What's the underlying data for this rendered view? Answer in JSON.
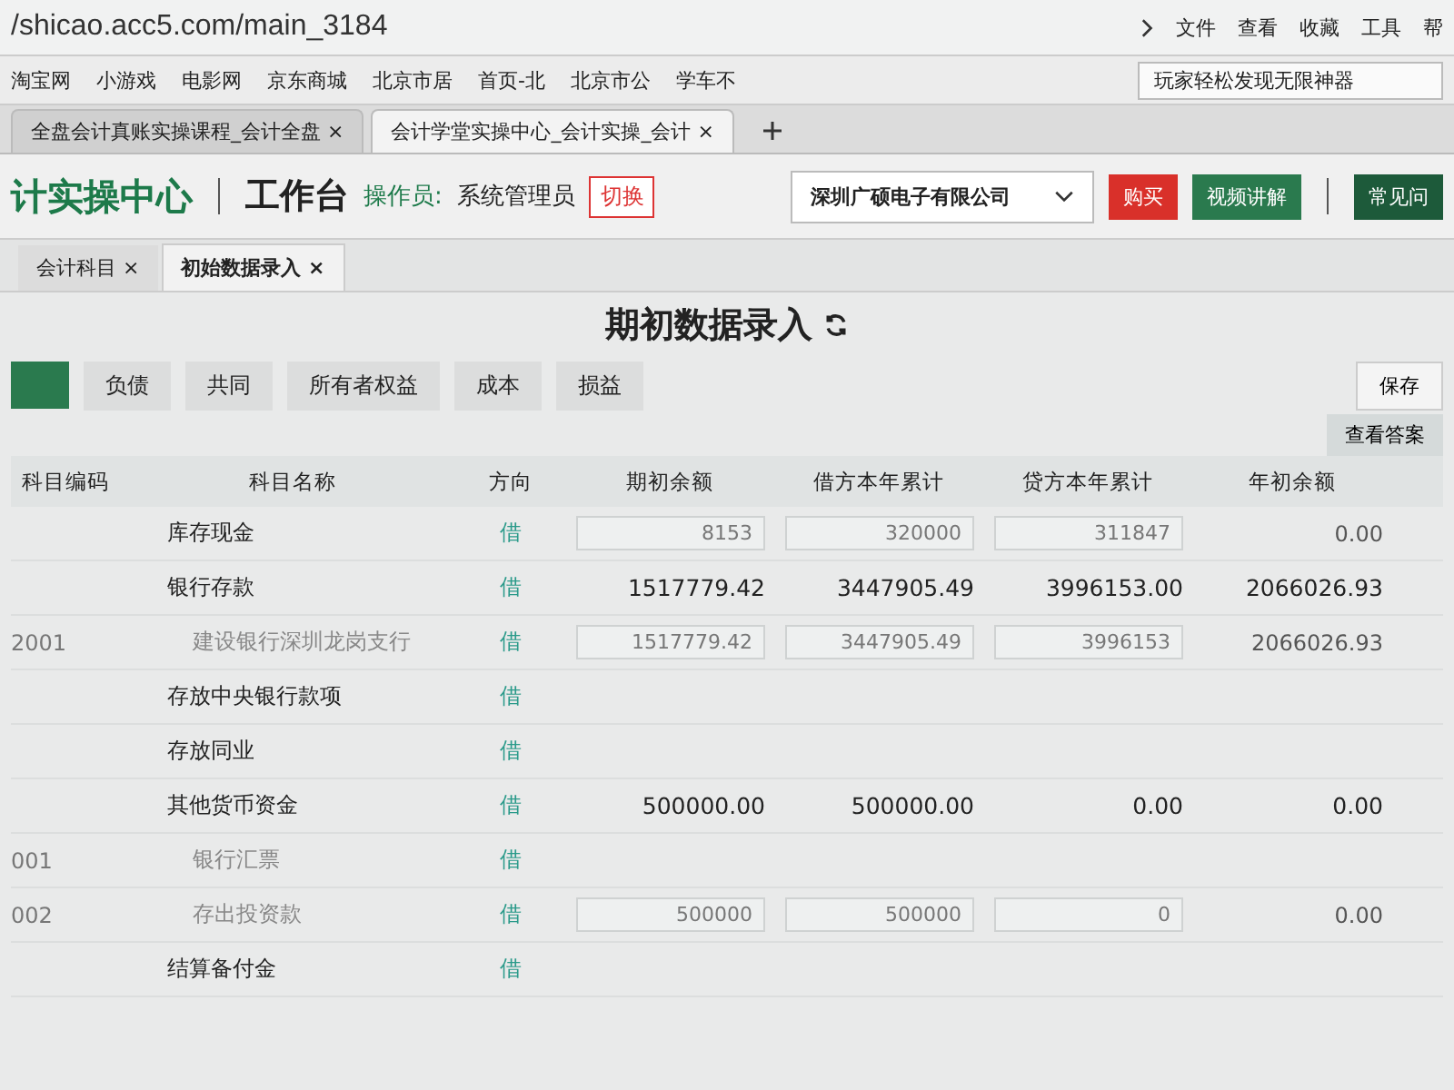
{
  "browser": {
    "url": "/shicao.acc5.com/main_3184",
    "menu": [
      "文件",
      "查看",
      "收藏",
      "工具",
      "帮"
    ],
    "bookmarks": [
      "淘宝网",
      "小游戏",
      "电影网",
      "京东商城",
      "北京市居",
      "首页-北",
      "北京市公",
      "学车不"
    ],
    "search": {
      "value": "玩家轻松发现无限神器"
    },
    "tabs": [
      {
        "title": "全盘会计真账实操课程_会计全盘",
        "close": "×",
        "selected": false
      },
      {
        "title": "会计学堂实操中心_会计实操_会计",
        "close": "×",
        "selected": true
      }
    ]
  },
  "header": {
    "logo": "计实操中心",
    "workspace": "工作台",
    "operator_label": "操作员:",
    "operator": "系统管理员",
    "switch": "切换",
    "company": "深圳广硕电子有限公司",
    "buy": "购买",
    "video": "视频讲解",
    "faq": "常见问"
  },
  "page_tabs": [
    {
      "label": "会计科目",
      "close": "×",
      "selected": false
    },
    {
      "label": "初始数据录入",
      "close": "×",
      "selected": true
    }
  ],
  "title": "期初数据录入",
  "category_tabs": [
    {
      "selected": true
    },
    {
      "label": "负债",
      "selected": false
    },
    {
      "label": "共同",
      "selected": false
    },
    {
      "label": "所有者权益",
      "selected": false
    },
    {
      "label": "成本",
      "selected": false
    },
    {
      "label": "损益",
      "selected": false
    }
  ],
  "save": "保存",
  "answer": "查看答案",
  "table": {
    "columns": [
      "科目编码",
      "科目名称",
      "方向",
      "期初余额",
      "借方本年累计",
      "贷方本年累计",
      "年初余额"
    ],
    "rows": [
      {
        "name": "库存现金",
        "direction": "借",
        "child": false,
        "kind": "input",
        "values": [
          "8153",
          "320000",
          "311847",
          "0.00"
        ]
      },
      {
        "name": "银行存款",
        "direction": "借",
        "child": false,
        "kind": "total",
        "values": [
          "1517779.42",
          "3447905.49",
          "3996153.00",
          "2066026.93"
        ]
      },
      {
        "code": "2001",
        "name": "建设银行深圳龙岗支行",
        "direction": "借",
        "child": true,
        "kind": "input",
        "values": [
          "1517779.42",
          "3447905.49",
          "3996153",
          "2066026.93"
        ]
      },
      {
        "name": "存放中央银行款项",
        "direction": "借",
        "child": false
      },
      {
        "name": "存放同业",
        "direction": "借",
        "child": false
      },
      {
        "name": "其他货币资金",
        "direction": "借",
        "child": false,
        "kind": "total",
        "values": [
          "500000.00",
          "500000.00",
          "0.00",
          "0.00"
        ]
      },
      {
        "code": "001",
        "name": "银行汇票",
        "direction": "借",
        "child": true
      },
      {
        "code": "002",
        "name": "存出投资款",
        "direction": "借",
        "child": true,
        "kind": "input",
        "values": [
          "500000",
          "500000",
          "0",
          "0.00"
        ]
      },
      {
        "name": "结算备付金",
        "direction": "借",
        "child": false
      }
    ]
  }
}
